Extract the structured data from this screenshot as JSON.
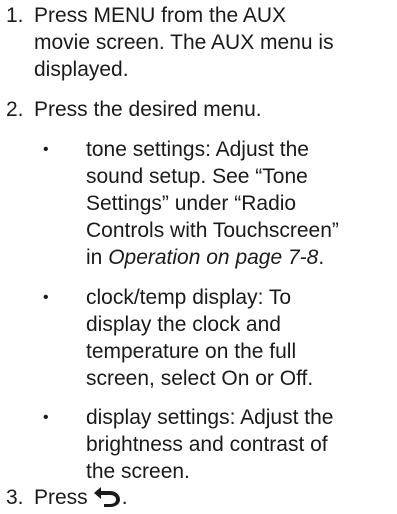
{
  "steps": [
    {
      "number": "1.",
      "text": "Press MENU from the AUX\nmovie screen. The AUX menu is\ndisplayed."
    },
    {
      "number": "2.",
      "text": "Press the desired menu."
    },
    {
      "number": "3.",
      "text": "Press",
      "trailing": ".",
      "icon": "back-arrow-icon"
    }
  ],
  "bullets": [
    {
      "symbol": "•",
      "text": "tone settings: Adjust the\nsound setup. See “Tone\nSettings” under “Radio\nControls with Touchscreen”\nin ",
      "ref_text": "Operation on page 7-8",
      "ref_tail": "."
    },
    {
      "symbol": "•",
      "text": "clock/temp display: To\ndisplay the clock and\ntemperature on the full\nscreen, select On or Off."
    },
    {
      "symbol": "•",
      "text": "display settings: Adjust the\nbrightness and contrast of\nthe screen."
    }
  ]
}
